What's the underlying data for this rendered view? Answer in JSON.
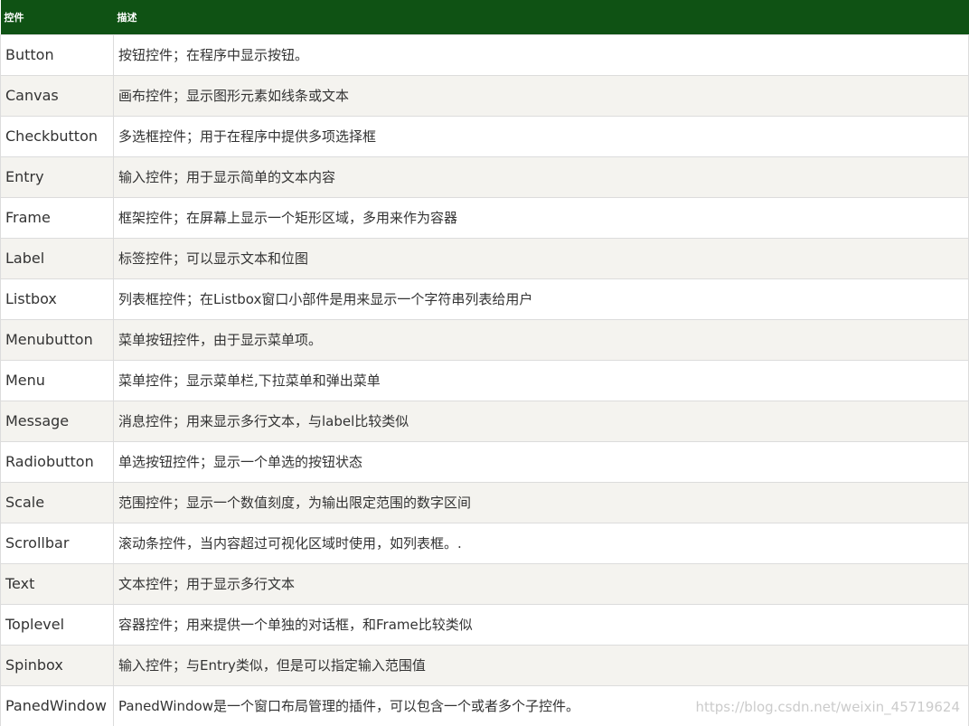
{
  "table": {
    "header": {
      "name": "控件",
      "description": "描述"
    },
    "rows": [
      {
        "name": "Button",
        "description": "按钮控件；在程序中显示按钮。"
      },
      {
        "name": "Canvas",
        "description": "画布控件；显示图形元素如线条或文本"
      },
      {
        "name": "Checkbutton",
        "description": "多选框控件；用于在程序中提供多项选择框"
      },
      {
        "name": "Entry",
        "description": "输入控件；用于显示简单的文本内容"
      },
      {
        "name": "Frame",
        "description": "框架控件；在屏幕上显示一个矩形区域，多用来作为容器"
      },
      {
        "name": "Label",
        "description": "标签控件；可以显示文本和位图"
      },
      {
        "name": "Listbox",
        "description": "列表框控件；在Listbox窗口小部件是用来显示一个字符串列表给用户"
      },
      {
        "name": "Menubutton",
        "description": "菜单按钮控件，由于显示菜单项。"
      },
      {
        "name": "Menu",
        "description": "菜单控件；显示菜单栏,下拉菜单和弹出菜单"
      },
      {
        "name": "Message",
        "description": "消息控件；用来显示多行文本，与label比较类似"
      },
      {
        "name": "Radiobutton",
        "description": "单选按钮控件；显示一个单选的按钮状态"
      },
      {
        "name": "Scale",
        "description": "范围控件；显示一个数值刻度，为输出限定范围的数字区间"
      },
      {
        "name": "Scrollbar",
        "description": "滚动条控件，当内容超过可视化区域时使用，如列表框。."
      },
      {
        "name": "Text",
        "description": "文本控件；用于显示多行文本"
      },
      {
        "name": "Toplevel",
        "description": "容器控件；用来提供一个单独的对话框，和Frame比较类似"
      },
      {
        "name": "Spinbox",
        "description": "输入控件；与Entry类似，但是可以指定输入范围值"
      },
      {
        "name": "PanedWindow",
        "description": "PanedWindow是一个窗口布局管理的插件，可以包含一个或者多个子控件。"
      }
    ]
  },
  "watermark": "https://blog.csdn.net/weixin_45719624"
}
